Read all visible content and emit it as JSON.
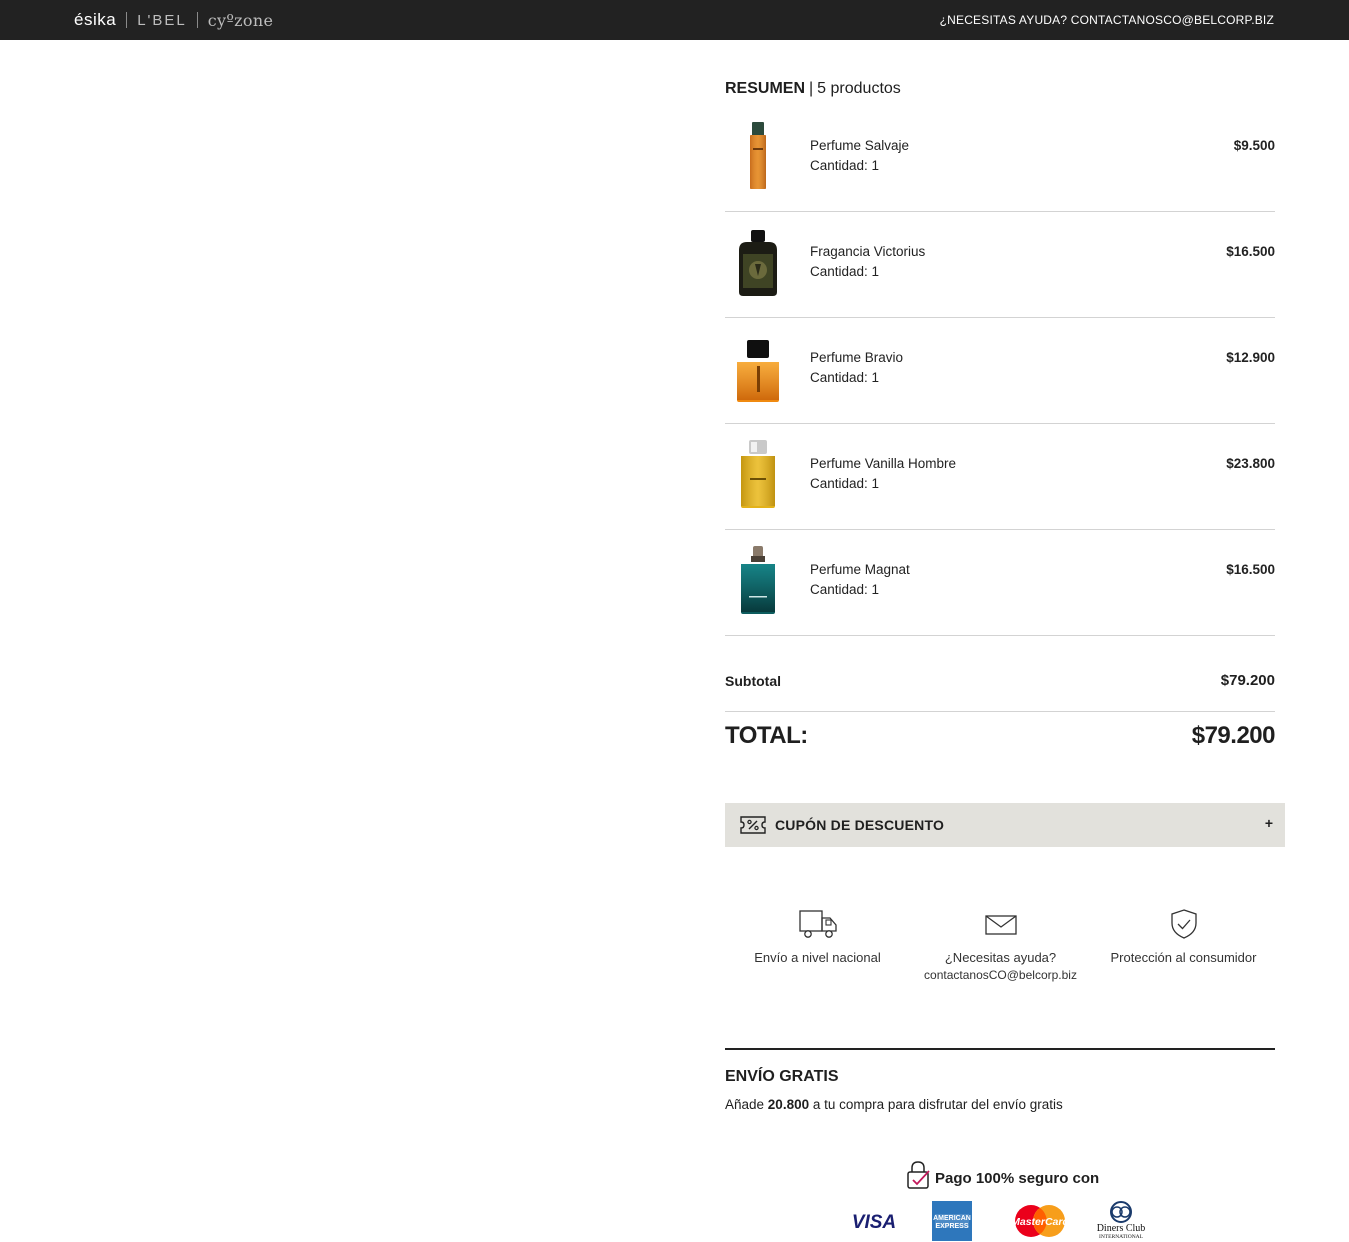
{
  "header": {
    "brands": [
      "ésika",
      "L'BEL",
      "cyºzone"
    ],
    "help_text": "¿NECESITAS AYUDA? CONTACTANOSCO@BELCORP.BIZ"
  },
  "summary": {
    "title": "RESUMEN",
    "separator": "|",
    "count_label": "5 productos",
    "items": [
      {
        "name": "Perfume Salvaje",
        "quantity": "Cantidad: 1",
        "price": "$9.500"
      },
      {
        "name": "Fragancia Victorius",
        "quantity": "Cantidad: 1",
        "price": "$16.500"
      },
      {
        "name": "Perfume Bravio",
        "quantity": "Cantidad: 1",
        "price": "$12.900"
      },
      {
        "name": "Perfume Vanilla Hombre",
        "quantity": "Cantidad: 1",
        "price": "$23.800"
      },
      {
        "name": "Perfume Magnat",
        "quantity": "Cantidad: 1",
        "price": "$16.500"
      }
    ],
    "subtotal_label": "Subtotal",
    "subtotal_value": "$79.200",
    "total_label": "TOTAL:",
    "total_value": "$79.200"
  },
  "coupon": {
    "label": "CUPÓN DE DESCUENTO",
    "toggle": "+",
    "icon": "discount-ticket-icon"
  },
  "features": [
    {
      "icon": "truck-icon",
      "text": "Envío a nivel nacional"
    },
    {
      "icon": "envelope-icon",
      "text": "¿Necesitas ayuda?",
      "sub": "contactanosCO@belcorp.biz"
    },
    {
      "icon": "shield-check-icon",
      "text": "Protección al consumidor"
    }
  ],
  "shipping": {
    "title": "ENVÍO GRATIS",
    "text_before": "Añade ",
    "amount": "20.800",
    "text_after": " a tu compra para disfrutar del envío gratis"
  },
  "payment": {
    "secure_label": "Pago 100% seguro con",
    "cards": [
      "VISA",
      "AMERICAN EXPRESS",
      "MasterCard",
      "Diners Club INTERNATIONAL"
    ]
  },
  "colors": {
    "topbar": "#222222",
    "coupon_bg": "#e2e1dc",
    "divider": "#d3d3d3",
    "visa": "#1a1f71",
    "amex": "#2e77bc",
    "mastercard_red": "#eb001b",
    "mastercard_orange": "#f79e1b"
  }
}
